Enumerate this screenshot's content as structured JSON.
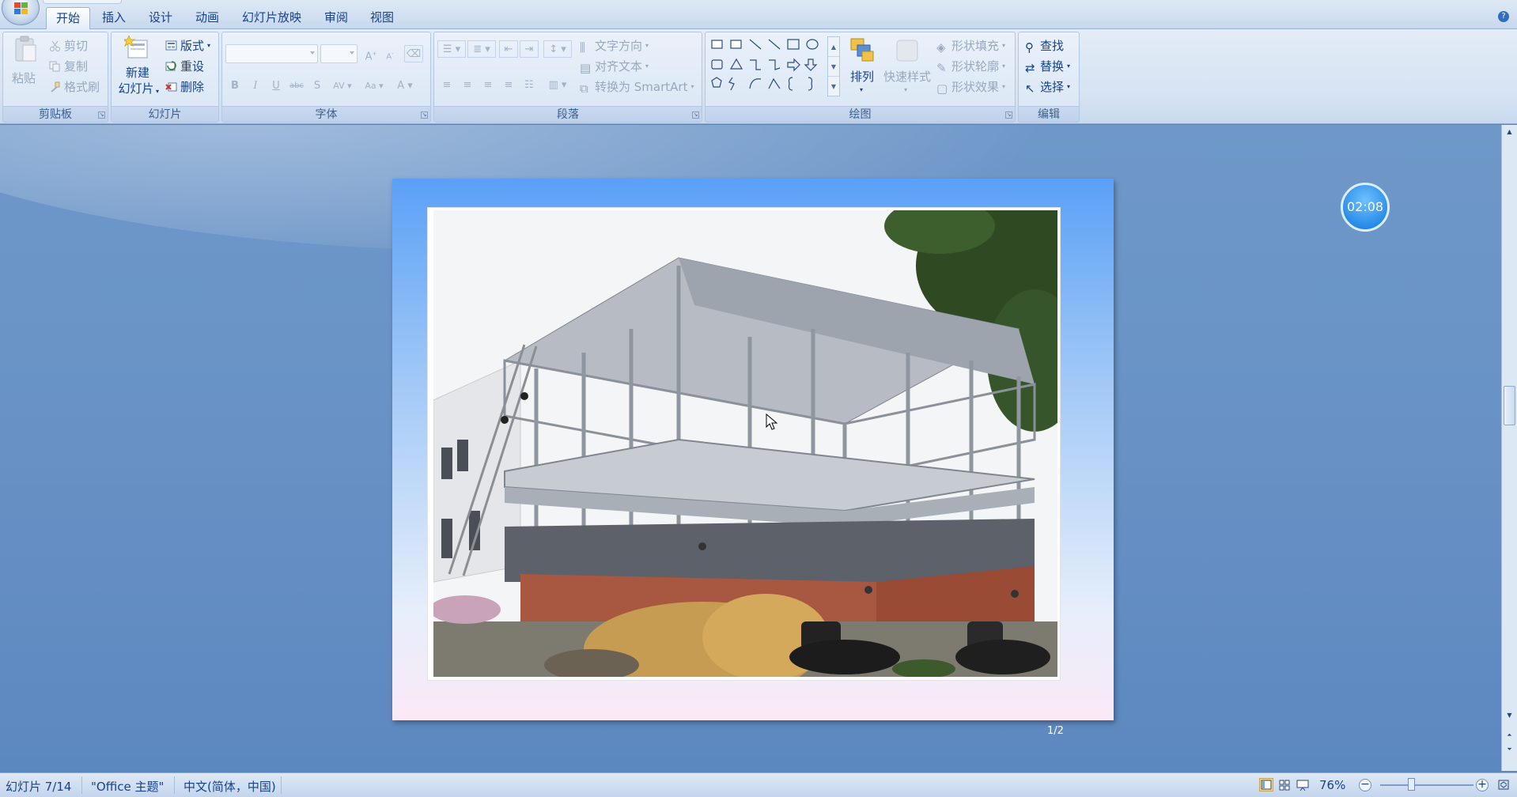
{
  "tabs": [
    "开始",
    "插入",
    "设计",
    "动画",
    "幻灯片放映",
    "审阅",
    "视图"
  ],
  "ribbon": {
    "clipboard": {
      "label": "剪贴板",
      "paste": "粘贴",
      "cut": "剪切",
      "copy": "复制",
      "format_painter": "格式刷"
    },
    "slides": {
      "label": "幻灯片",
      "new_slide_line1": "新建",
      "new_slide_line2": "幻灯片",
      "layout": "版式",
      "reset": "重设",
      "delete": "删除"
    },
    "font": {
      "label": "字体",
      "grow": "A",
      "shrink": "A",
      "bold": "B",
      "italic": "I",
      "underline": "U",
      "strike": "abc",
      "shadow": "S",
      "spacing": "AV",
      "case": "Aa",
      "color": "A"
    },
    "paragraph": {
      "label": "段落",
      "text_direction": "文字方向",
      "align_text": "对齐文本",
      "convert_smartart": "转换为 SmartArt"
    },
    "drawing": {
      "label": "绘图",
      "arrange": "排列",
      "quick_styles": "快速样式",
      "shape_fill": "形状填充",
      "shape_outline": "形状轮廓",
      "shape_effects": "形状效果"
    },
    "editing": {
      "label": "编辑",
      "find": "查找",
      "replace": "替换",
      "select": "选择"
    }
  },
  "slide": {
    "page_indicator": "1/2"
  },
  "timer": "02:08",
  "status": {
    "slide_info": "幻灯片 7/14",
    "theme": "\"Office 主题\"",
    "language": "中文(简体，中国)",
    "zoom": "76%"
  },
  "colors": {
    "accent": "#15428b",
    "ribbon_bg": "#dbe6f4",
    "workspace_bg": "#6891c5",
    "timer": "#2a8de8"
  }
}
